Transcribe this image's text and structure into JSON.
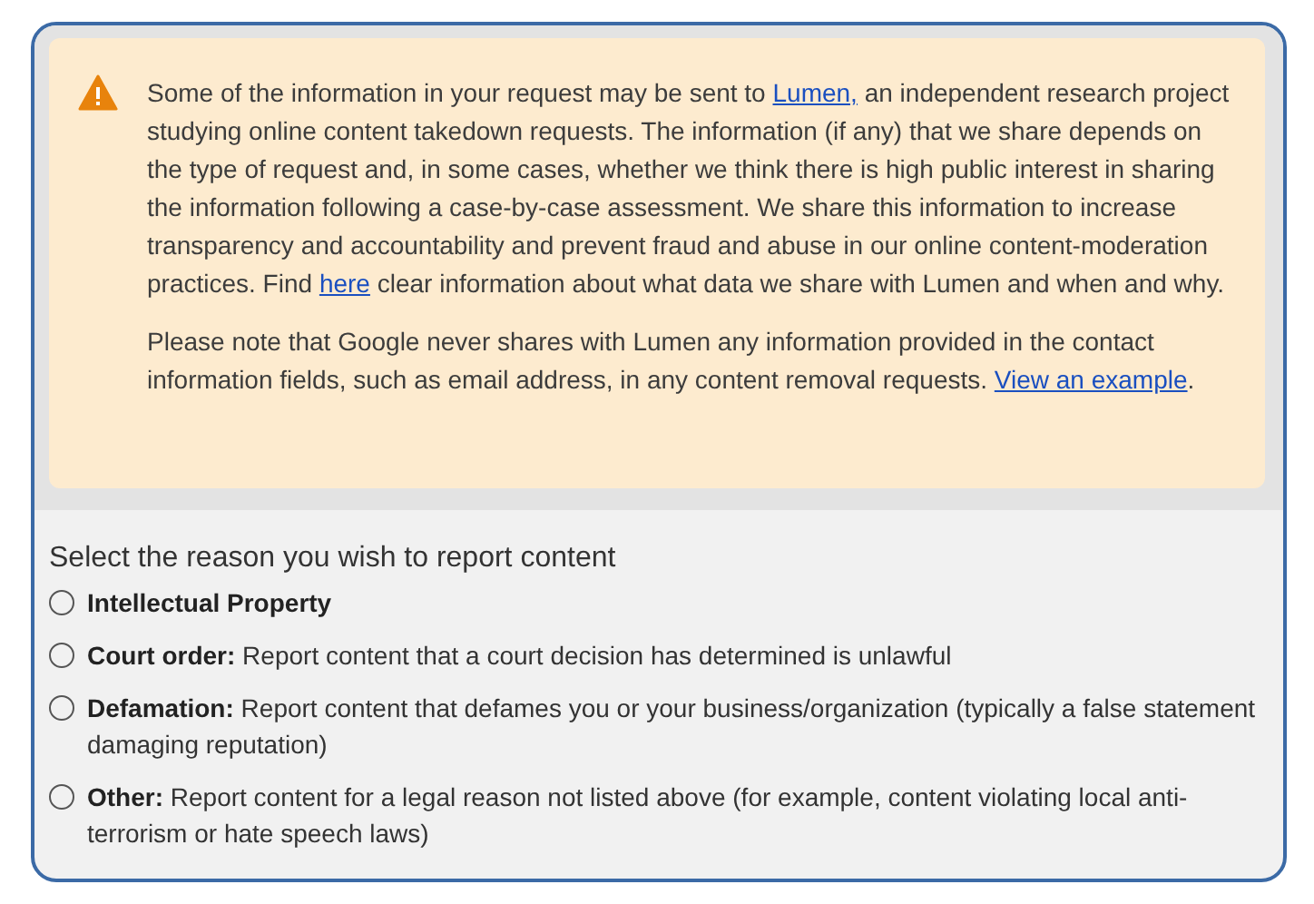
{
  "notice": {
    "paragraphs": [
      [
        {
          "text": "Some of the information in your request may be sent to "
        },
        {
          "text": "Lumen,",
          "link": true
        },
        {
          "text": " an independent research project studying online content takedown requests. The information (if any) that we share depends on the type of request and, in some cases, whether we think there is high public interest in sharing the information following a case-by-case assessment. We share this information to increase transparency and accountability and prevent fraud and abuse in our online content-moderation practices. Find "
        },
        {
          "text": "here",
          "link": true
        },
        {
          "text": " clear information about what data we share with Lumen and when and why."
        }
      ],
      [
        {
          "text": "Please note that Google never shares with Lumen any information provided in the contact information fields, such as email address, in any content removal requests. "
        },
        {
          "text": "View an example",
          "link": true
        },
        {
          "text": "."
        }
      ]
    ]
  },
  "reason": {
    "heading": "Select the reason you wish to report content",
    "options": [
      {
        "label": "Intellectual Property",
        "selected": false
      },
      {
        "label": "Court order:",
        "description": "Report content that a court decision has determined is unlawful",
        "selected": false
      },
      {
        "label": "Defamation:",
        "description": "Report content that defames you or your business/organization (typically a false statement damaging reputation)",
        "selected": false
      },
      {
        "label": "Other:",
        "description": "Report content for a legal reason not listed above (for example, content violating local anti-terrorism or hate speech laws)",
        "selected": false
      }
    ]
  }
}
